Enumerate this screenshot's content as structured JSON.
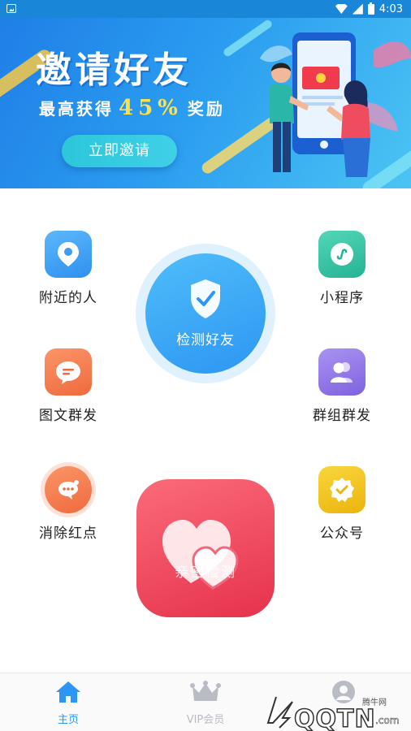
{
  "status_bar": {
    "time": "4:03"
  },
  "banner": {
    "title": "邀请好友",
    "subtitle_prefix": "最高获得",
    "percent": "45%",
    "subtitle_suffix": "奖励",
    "button_label": "立即邀请"
  },
  "features": {
    "nearby": {
      "label": "附近的人",
      "icon": "location-pin-icon",
      "color": "#3fa4f5"
    },
    "mini_program": {
      "label": "小程序",
      "icon": "mini-program-icon",
      "color": "#36c5a6"
    },
    "detect_friends": {
      "label": "检测好友",
      "icon": "shield-check-icon",
      "color": "#2d96f2"
    },
    "graphic_broadcast": {
      "label": "图文群发",
      "icon": "chat-bubble-icon",
      "color": "#f47a4e"
    },
    "group_broadcast": {
      "label": "群组群发",
      "icon": "group-users-icon",
      "color": "#9377e6"
    },
    "clear_red_dot": {
      "label": "消除红点",
      "icon": "chat-dot-icon",
      "color": "#f47a4e"
    },
    "official_account": {
      "label": "公众号",
      "icon": "badge-check-icon",
      "color": "#f2c51a"
    },
    "hearts": {
      "label": "亲密检测",
      "icon": "hearts-icon",
      "color": "#ef4c5f"
    }
  },
  "bottom_nav": {
    "items": [
      {
        "label": "主页",
        "icon": "home-icon",
        "active": true
      },
      {
        "label": "VIP会员",
        "icon": "crown-icon",
        "active": false
      },
      {
        "label": "我的",
        "icon": "profile-icon",
        "active": false
      }
    ]
  },
  "watermark": {
    "brand": "QQTN",
    "suffix": ".com",
    "cn": "腾牛网"
  },
  "colors": {
    "accent": "#1a86d8",
    "active_nav": "#2d96f2",
    "inactive_nav": "#b9bcc4"
  }
}
